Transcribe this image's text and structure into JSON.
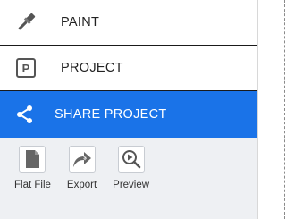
{
  "menu": {
    "items": [
      {
        "label": "PAINT",
        "icon": "paintbrush-icon"
      },
      {
        "label": "PROJECT",
        "icon": "project-icon"
      },
      {
        "label": "SHARE PROJECT",
        "icon": "share-icon",
        "active": true
      }
    ]
  },
  "share_tools": {
    "items": [
      {
        "label": "Flat File",
        "icon": "flat-file-icon"
      },
      {
        "label": "Export",
        "icon": "export-icon"
      },
      {
        "label": "Preview",
        "icon": "preview-icon"
      }
    ]
  },
  "colors": {
    "accent": "#1a73e8",
    "sub_background": "#eef0f3",
    "text": "#222222"
  }
}
